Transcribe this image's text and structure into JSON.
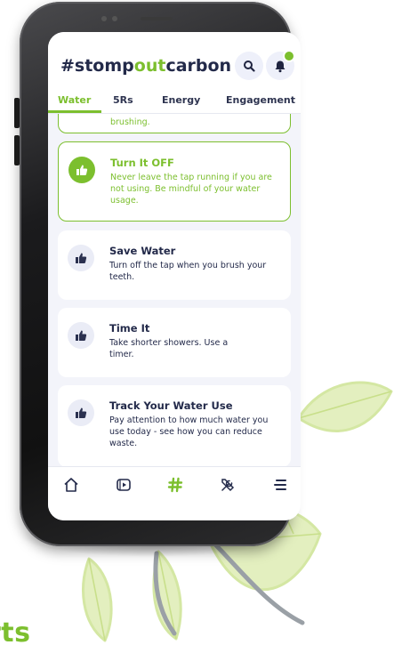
{
  "app": {
    "title_prefix": "#stomp",
    "title_accent": "out",
    "title_suffix": "carbon"
  },
  "header": {
    "search_icon": "search-icon",
    "bell_icon": "bell-icon"
  },
  "tabs": [
    {
      "label": "Water",
      "active": true
    },
    {
      "label": "5Rs",
      "active": false
    },
    {
      "label": "Energy",
      "active": false
    },
    {
      "label": "Engagement",
      "active": false
    }
  ],
  "cards": [
    {
      "title": "",
      "body": "brushing."
    },
    {
      "title": "Turn It OFF",
      "body": "Never leave the tap running if you are not using. Be mindful of your water usage.",
      "active": true
    },
    {
      "title": "Save Water",
      "body": "Turn off the tap when you brush your teeth."
    },
    {
      "title": "Time It",
      "body": "Take shorter showers. Use a timer."
    },
    {
      "title": "Track Your Water Use",
      "body": "Pay attention to how much water you use today - see how you can reduce waste."
    }
  ],
  "bottom_nav": [
    "home-icon",
    "video-icon",
    "hashtag-icon",
    "tools-icon",
    "menu-icon"
  ],
  "footer_word": "rts",
  "colors": {
    "accent": "#7cbf2e",
    "text": "#232a4a",
    "leaf": "#dcebb2"
  }
}
